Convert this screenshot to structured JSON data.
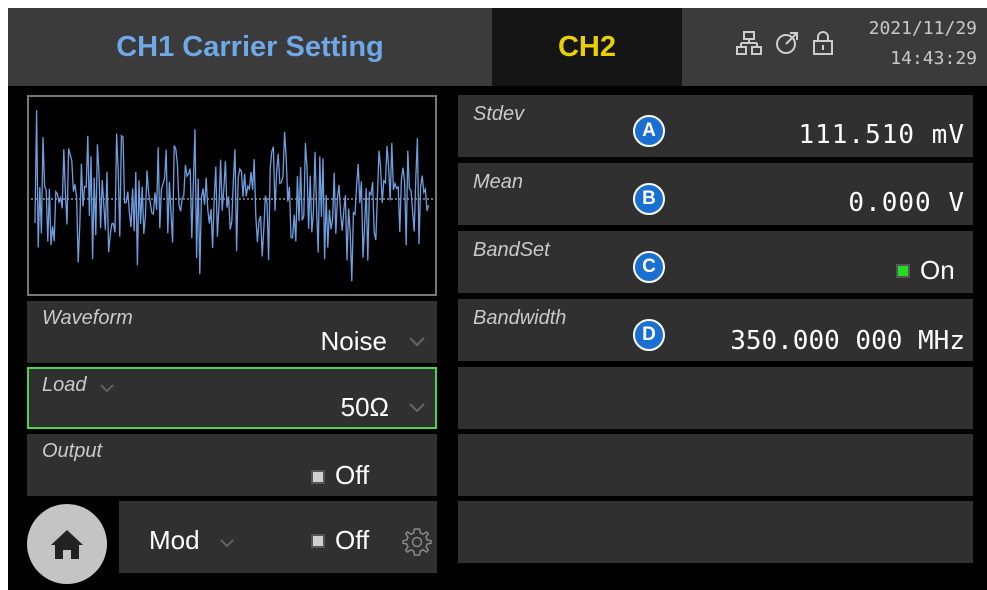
{
  "header": {
    "title": "CH1 Carrier Setting",
    "channel_tab": "CH2",
    "date": "2021/11/29",
    "time": "14:43:29",
    "icons": [
      "network-icon",
      "power-icon",
      "lock-icon"
    ]
  },
  "left": {
    "waveform": {
      "label": "Waveform",
      "value": "Noise"
    },
    "load": {
      "label": "Load",
      "value": "50Ω"
    },
    "output": {
      "label": "Output",
      "state": "Off"
    },
    "mod": {
      "label": "Mod",
      "state": "Off"
    }
  },
  "right": {
    "stdev": {
      "label": "Stdev",
      "badge": "A",
      "value": "111.510 mV"
    },
    "mean": {
      "label": "Mean",
      "badge": "B",
      "value": "0.000 V"
    },
    "bandset": {
      "label": "BandSet",
      "badge": "C",
      "state": "On"
    },
    "bandwidth": {
      "label": "Bandwidth",
      "badge": "D",
      "value": "350.000 000 MHz"
    }
  },
  "colors": {
    "title_blue": "#6fa8e6",
    "ch2_yellow": "#e9d000",
    "load_border": "#4cd44c",
    "waveform_line": "#6f9ede",
    "badge_blue": "#1a6fd0",
    "on_green": "#22dd22"
  }
}
